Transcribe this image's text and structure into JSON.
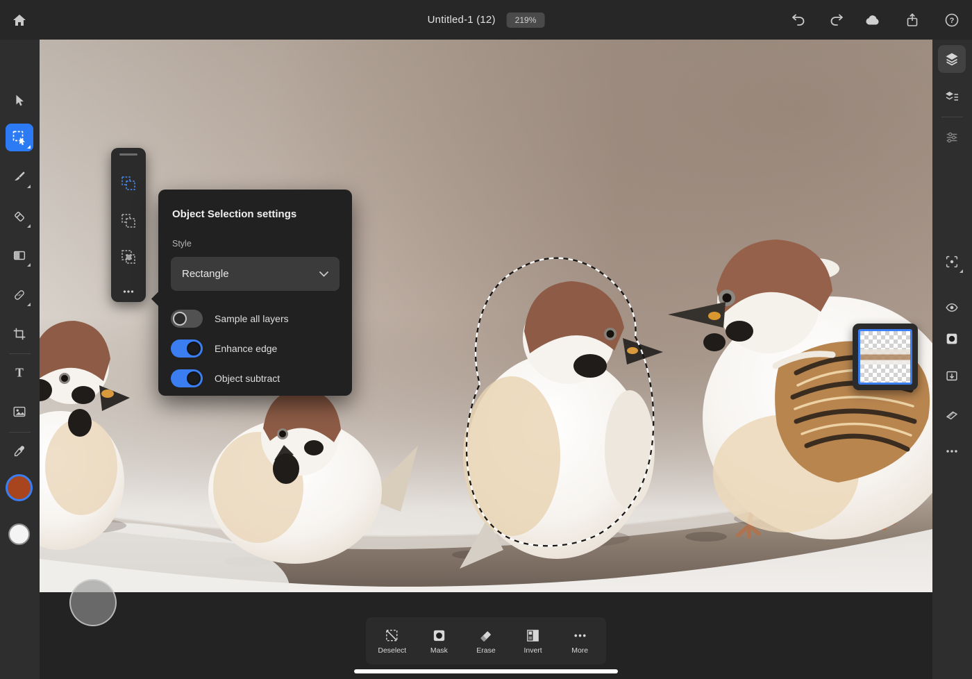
{
  "top_bar": {
    "title": "Untitled-1 (12)",
    "zoom_badge": "219%",
    "left_icons": [
      "home"
    ],
    "right_icons": [
      "undo",
      "redo",
      "cloud-sync",
      "share",
      "help"
    ]
  },
  "left_toolbar": {
    "active_tool": "object-selection",
    "tools": [
      "move",
      "lasso",
      "object-selection",
      "brush",
      "eraser",
      "fill",
      "healing-brush",
      "crop",
      "type",
      "place-image",
      "eyedropper"
    ],
    "foreground_color": "#a8451f",
    "background_color": "#f4f4f4"
  },
  "tool_options_flyout": {
    "active_item": "add-selection",
    "items": [
      "add-selection",
      "subtract-selection",
      "intersect-selection",
      "more"
    ]
  },
  "popup": {
    "title": "Object Selection settings",
    "style_label": "Style",
    "style_value": "Rectangle",
    "toggles": [
      {
        "label": "Sample all layers",
        "on": false
      },
      {
        "label": "Enhance edge",
        "on": true
      },
      {
        "label": "Object subtract",
        "on": true
      }
    ]
  },
  "right_toolbar": {
    "active": "layers",
    "icons": [
      "layers",
      "layer-properties",
      "adjustments",
      "select-subject",
      "eye",
      "mask",
      "send-to",
      "cleanup",
      "more"
    ]
  },
  "layers_panel": {
    "selected_layer_border": "#3b7ef2"
  },
  "bottom_bar": {
    "items": [
      {
        "icon": "deselect",
        "label": "Deselect"
      },
      {
        "icon": "mask",
        "label": "Mask"
      },
      {
        "icon": "erase",
        "label": "Erase"
      },
      {
        "icon": "invert",
        "label": "Invert"
      },
      {
        "icon": "more",
        "label": "More"
      }
    ]
  },
  "colors": {
    "accent_blue": "#3b7ef2",
    "top_bar_bg": "#272727",
    "rail_bg": "#2e2e2e",
    "popup_bg": "#212121",
    "dock_bg": "#2b2b2b",
    "app_bg": "#232323"
  }
}
